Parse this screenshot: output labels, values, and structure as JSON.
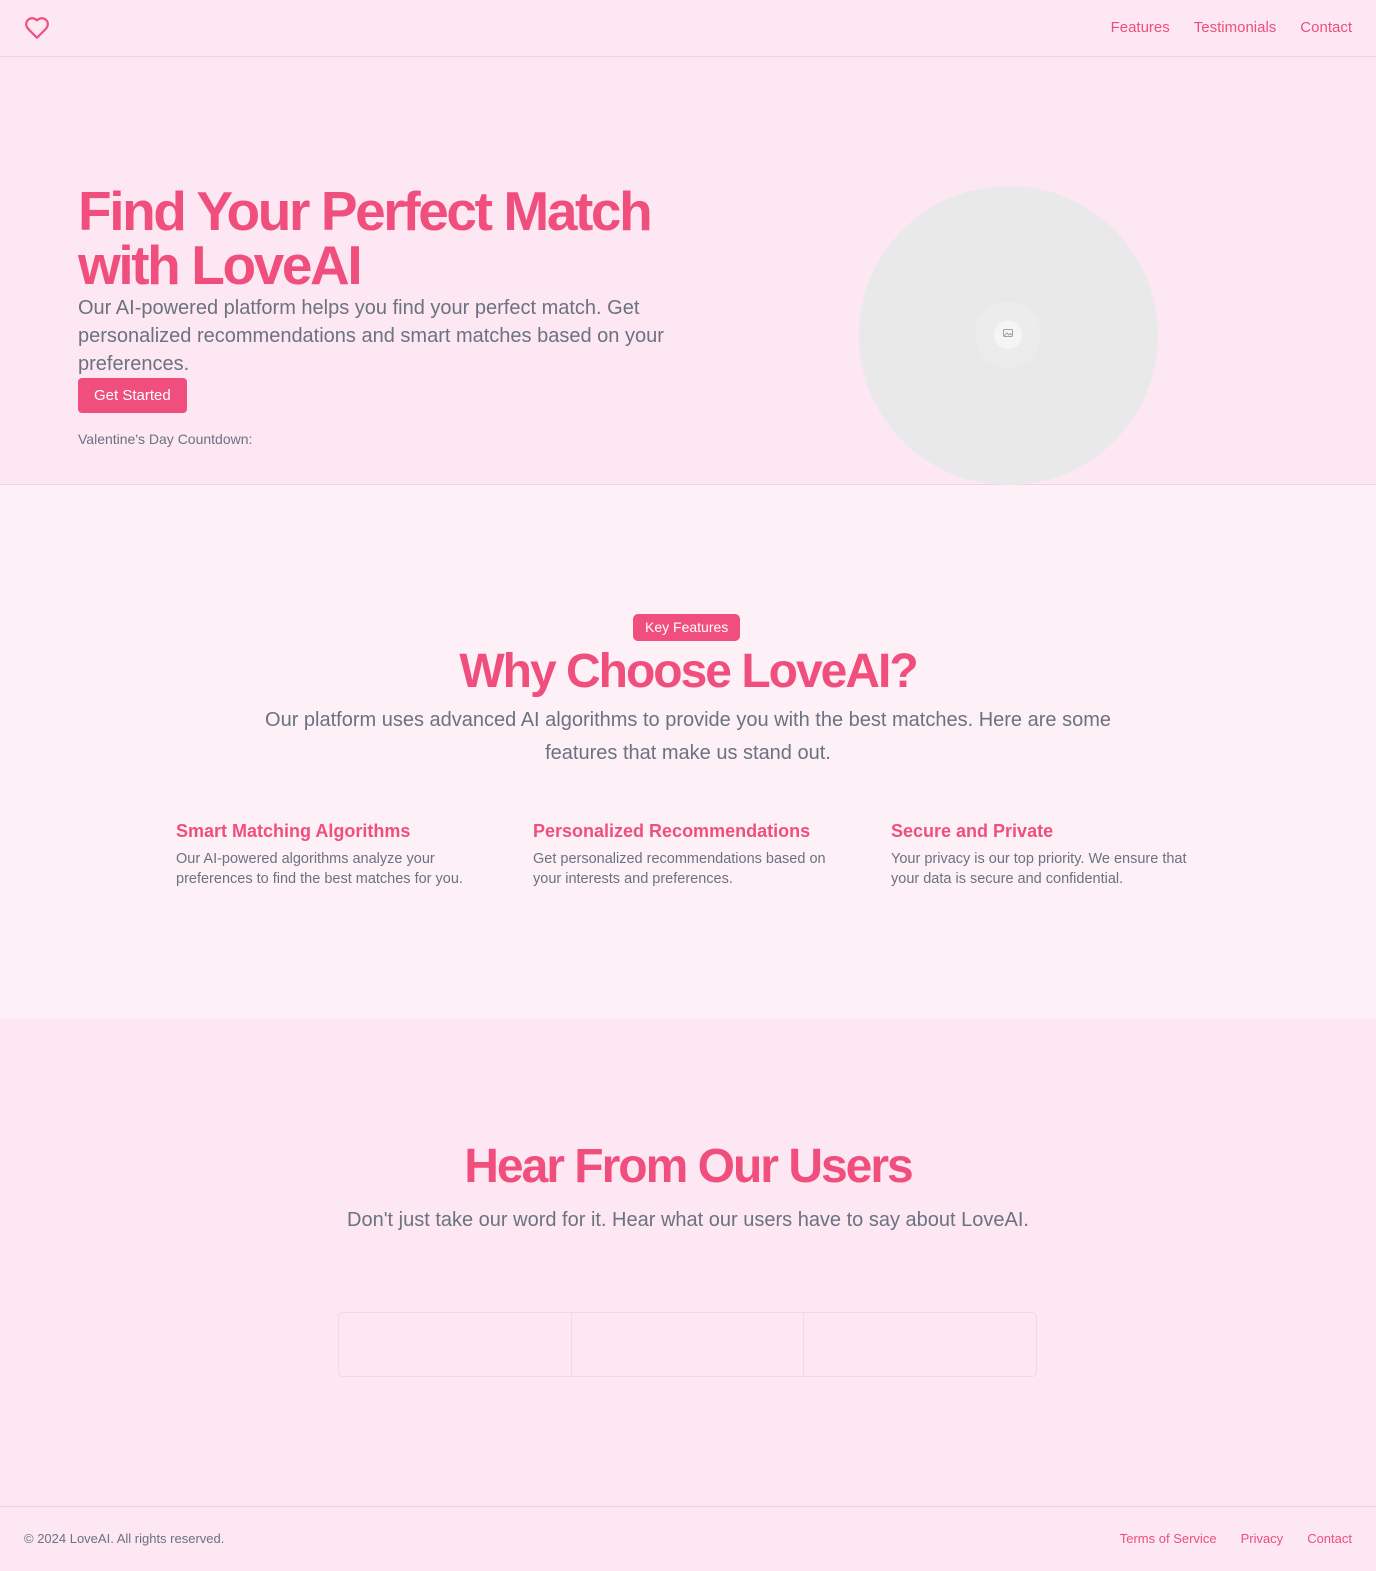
{
  "header": {
    "logo_icon": "heart-icon",
    "nav": [
      "Features",
      "Testimonials",
      "Contact"
    ]
  },
  "hero": {
    "title": "Find Your Perfect Match with LoveAI",
    "subtitle": "Our AI-powered platform helps you find your perfect match. Get personalized recommendations and smart matches based on your preferences.",
    "cta": "Get Started",
    "countdown_label": "Valentine's Day Countdown:",
    "image_icon": "image-placeholder-icon"
  },
  "features": {
    "badge": "Key Features",
    "title": "Why Choose LoveAI?",
    "subtitle": "Our platform uses advanced AI algorithms to provide you with the best matches. Here are some features that make us stand out.",
    "items": [
      {
        "title": "Smart Matching Algorithms",
        "desc": "Our AI-powered algorithms analyze your preferences to find the best matches for you."
      },
      {
        "title": "Personalized Recommendations",
        "desc": "Get personalized recommendations based on your interests and preferences."
      },
      {
        "title": "Secure and Private",
        "desc": "Your privacy is our top priority. We ensure that your data is secure and confidential."
      }
    ]
  },
  "testimonials": {
    "title": "Hear From Our Users",
    "subtitle": "Don't just take our word for it. Hear what our users have to say about LoveAI."
  },
  "footer": {
    "copyright": "© 2024 LoveAI. All rights reserved.",
    "links": [
      "Terms of Service",
      "Privacy",
      "Contact"
    ]
  },
  "colors": {
    "accent": "#f04f7e",
    "background": "#fce7f3",
    "features_background": "#fdf0f6",
    "body_text": "#6b7280"
  }
}
